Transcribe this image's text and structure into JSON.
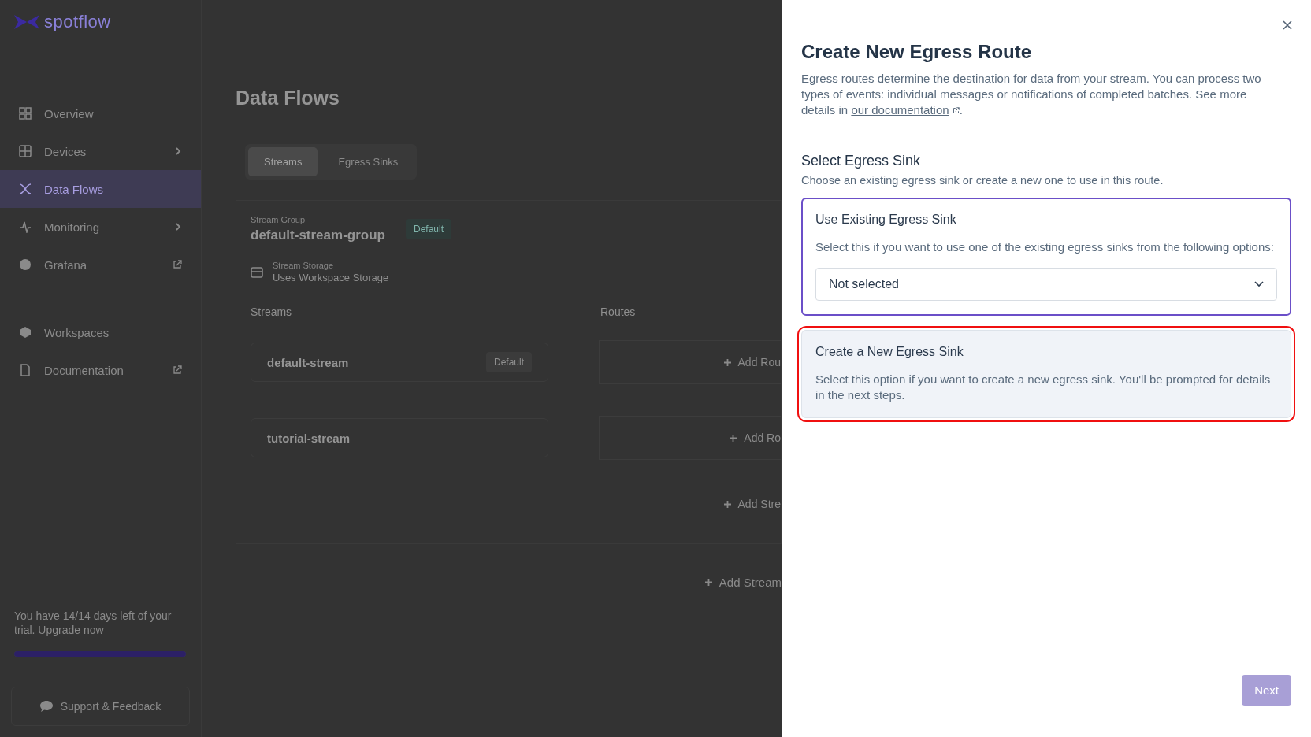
{
  "sidebar": {
    "logo": "spotflow",
    "items": [
      {
        "label": "Overview",
        "selected": false,
        "kind": "plain"
      },
      {
        "label": "Devices",
        "selected": false,
        "kind": "expandable"
      },
      {
        "label": "Data Flows",
        "selected": true,
        "kind": "plain"
      },
      {
        "label": "Monitoring",
        "selected": false,
        "kind": "expandable"
      },
      {
        "label": "Grafana",
        "selected": false,
        "kind": "external"
      }
    ],
    "secondary_items": [
      {
        "label": "Workspaces",
        "selected": false,
        "kind": "plain"
      },
      {
        "label": "Documentation",
        "selected": false,
        "kind": "external"
      }
    ],
    "trial": {
      "text": "You have 14/14 days left of your trial.",
      "link": "Upgrade now",
      "level": 1
    },
    "support_button": "Support & Feedback"
  },
  "main": {
    "title": "Data Flows",
    "tabs": [
      {
        "label": "Streams",
        "selected": true
      },
      {
        "label": "Egress Sinks",
        "selected": false
      }
    ],
    "stream_group": {
      "label": "Stream Group",
      "name": "default-stream-group",
      "badge": "Default"
    },
    "storage": {
      "label": "Stream Storage",
      "value": "Uses Workspace Storage"
    },
    "columns": [
      "Streams",
      "Routes"
    ],
    "streams": [
      {
        "name": "default-stream",
        "badge": "Default",
        "route_action": "Add Rou"
      },
      {
        "name": "tutorial-stream",
        "route_action": "Add Ro"
      }
    ],
    "add_stream_group_action": "Add Stre",
    "add_stream_action": "Add Stream"
  },
  "panel": {
    "title": "Create New Egress Route",
    "description": "Egress routes determine the destination for data from your stream. You can process two types of events: individual messages or notifications of completed batches. See more details in ",
    "description_link": "our documentation",
    "description_end": ".",
    "section_title": "Select Egress Sink",
    "section_subtitle": "Choose an existing egress sink or create a new one to use in this route.",
    "options": [
      {
        "kind": "select",
        "title": "Use Existing Egress Sink",
        "description": "Select this if you want to use one of the existing egress sinks from the following options:",
        "select_value": "Not selected",
        "selected": true,
        "highlighted": false
      },
      {
        "kind": "plain",
        "title": "Create a New Egress Sink",
        "description": "Select this option if you want to create a new egress sink. You'll be prompted for details in the next steps.",
        "selected": false,
        "highlighted": true
      }
    ],
    "next_button": {
      "label": "Next",
      "disabled": true
    }
  }
}
